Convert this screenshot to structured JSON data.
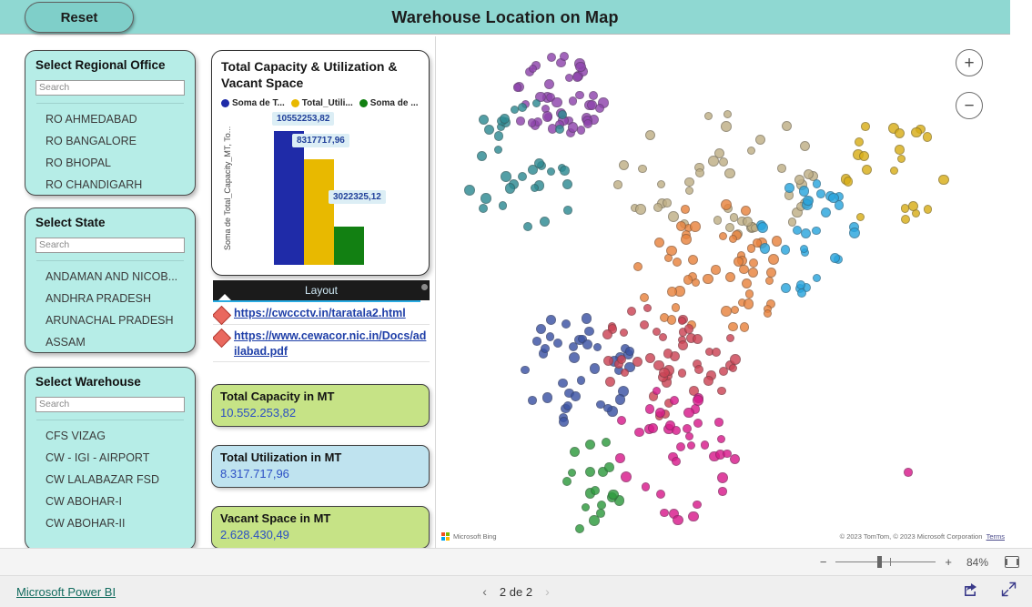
{
  "header": {
    "title": "Warehouse Location on Map",
    "reset_label": "Reset"
  },
  "slicers": [
    {
      "id": "ro",
      "title": "Select Regional Office",
      "search_placeholder": "Search",
      "search_value": "",
      "items": [
        "RO AHMEDABAD",
        "RO BANGALORE",
        "RO BHOPAL",
        "RO CHANDIGARH"
      ]
    },
    {
      "id": "state",
      "title": "Select State",
      "search_placeholder": "Search",
      "search_value": "",
      "items": [
        "ANDAMAN AND NICOB...",
        "ANDHRA PRADESH",
        "ARUNACHAL PRADESH",
        "ASSAM"
      ]
    },
    {
      "id": "warehouse",
      "title": "Select Warehouse",
      "search_placeholder": "Search",
      "search_value": "",
      "items": [
        "CFS VIZAG",
        "CW - IGI - AIRPORT",
        "CW LALABAZAR FSD",
        "CW ABOHAR-I",
        "CW ABOHAR-II"
      ]
    }
  ],
  "chart_data": {
    "type": "bar",
    "title": "Total Capacity & Utilization & Vacant Space",
    "categories": [
      "Total Capacity",
      "Total Utilization",
      "Vacant Space"
    ],
    "values": [
      10552253.82,
      8317717.96,
      3022325.12
    ],
    "value_labels": [
      "10552253,82",
      "8317717,96",
      "3022325,12"
    ],
    "colors": [
      "#1F2BA8",
      "#E8B900",
      "#128012"
    ],
    "legend": [
      "Soma de T...",
      "Total_Utili...",
      "Soma de ..."
    ],
    "legend_position": "top",
    "ylabel": "Soma de Total_Capacity_MT, To...",
    "xlabel": "",
    "ylim": [
      0,
      11500000
    ],
    "grid": false
  },
  "layout_table": {
    "column_header": "Layout",
    "rows": [
      {
        "url": "https://cwccctv.in/taratala2.html"
      },
      {
        "url": "https://www.cewacor.nic.in/Docs/adilabad.pdf"
      }
    ]
  },
  "kpis": [
    {
      "id": "capacity",
      "title": "Total Capacity in MT",
      "value": "10.552.253,82",
      "color": "#C6E386"
    },
    {
      "id": "utilization",
      "title": "Total Utilization in MT",
      "value": "8.317.717,96",
      "color": "#BFE3EF"
    },
    {
      "id": "vacant",
      "title": "Vacant Space in MT",
      "value": "2.628.430,49",
      "color": "#C6E386"
    }
  ],
  "map": {
    "zoom_in_label": "+",
    "zoom_out_label": "−",
    "provider_label": "Microsoft Bing",
    "attribution": "© 2023 TomTom, © 2023 Microsoft Corporation",
    "terms_label": "Terms"
  },
  "zoom_bar": {
    "minus_label": "−",
    "plus_label": "+",
    "percent": "84%"
  },
  "footer": {
    "powerbi_label": "Microsoft Power BI",
    "prev_arrow": "‹",
    "page_text": "2 de 2",
    "next_arrow": "›"
  }
}
